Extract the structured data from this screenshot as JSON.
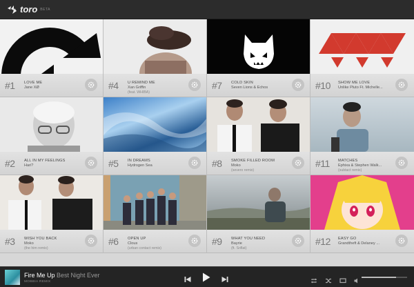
{
  "app": {
    "name": "toro",
    "badge": "BETA"
  },
  "tiles": [
    {
      "rank": "#1",
      "title": "LOVE ME",
      "artist": "Jane XØ",
      "remix": ""
    },
    {
      "rank": "#4",
      "title": "U REMIND ME",
      "artist": "Xan Griffin",
      "remix": "(feat. WHIBA)"
    },
    {
      "rank": "#7",
      "title": "COLD SKIN",
      "artist": "Seven Lions & Echos",
      "remix": ""
    },
    {
      "rank": "#10",
      "title": "SHOW ME LOVE",
      "artist": "Unlike Pluto Ft. Michelle...",
      "remix": ""
    },
    {
      "rank": "#2",
      "title": "ALL IN MY FEELINGS",
      "artist": "Hari?",
      "remix": ""
    },
    {
      "rank": "#5",
      "title": "IN DREAMS",
      "artist": "Hydrogen Sea",
      "remix": ""
    },
    {
      "rank": "#8",
      "title": "SMOKE FILLED ROOM",
      "artist": "Moko",
      "remix": "(severo remix)"
    },
    {
      "rank": "#11",
      "title": "MATCHES",
      "artist": "Ephixa & Stephen Walk...",
      "remix": "(subtact remix)"
    },
    {
      "rank": "#3",
      "title": "WISH YOU BACK",
      "artist": "Moko",
      "remix": "(the him remix)"
    },
    {
      "rank": "#6",
      "title": "OPEN UP",
      "artist": "Clous",
      "remix": "(urban contact remix)"
    },
    {
      "rank": "#9",
      "title": "WHAT YOU NEED",
      "artist": "Bayrie",
      "remix": "(ft. Sriflat)"
    },
    {
      "rank": "#12",
      "title": "EASY GO",
      "artist": "Grandtheft & Delaney ...",
      "remix": ""
    }
  ],
  "player": {
    "song": "Fire Me Up",
    "album": "Best Night Ever",
    "sub": "MOBBIA REMIX",
    "volume": 0.75
  },
  "icons": {
    "logo": "toro-logo-icon",
    "tile_action": "gear-icon",
    "prev": "skip-back-icon",
    "play": "play-icon",
    "next": "skip-forward-icon",
    "repeat": "repeat-icon",
    "shuffle": "shuffle-icon",
    "screen": "screen-icon",
    "volume": "volume-icon"
  }
}
